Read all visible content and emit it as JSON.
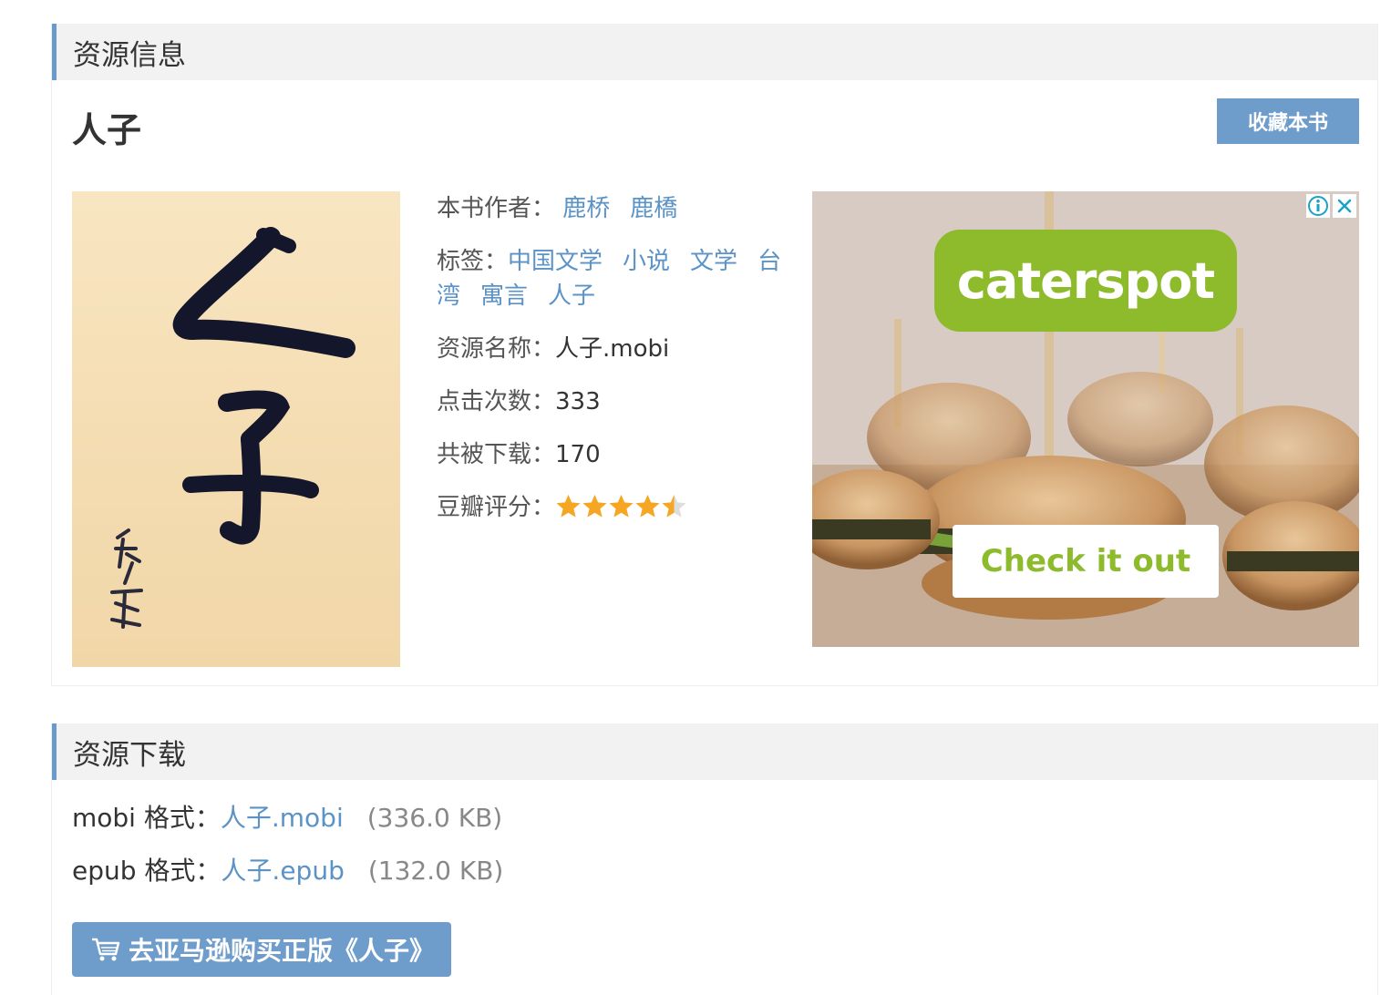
{
  "info_panel": {
    "heading": "资源信息",
    "book_title": "人子",
    "favorite_label": "收藏本书",
    "cover_calligraphy": "人子",
    "cover_signature": "鹿橋",
    "author_label": "本书作者：",
    "authors": [
      "鹿桥",
      "鹿橋"
    ],
    "tags_label": "标签：",
    "tags": [
      "中国文学",
      "小说",
      "文学",
      "台湾",
      "寓言",
      "人子"
    ],
    "resource_name_label": "资源名称：",
    "resource_name": "人子.mobi",
    "clicks_label": "点击次数：",
    "clicks": "333",
    "downloads_label": "共被下载：",
    "downloads": "170",
    "rating_label": "豆瓣评分：",
    "rating_stars": 4.5,
    "rating_max": 5
  },
  "ad": {
    "brand": "caterspot",
    "cta": "Check it out",
    "icons": [
      "info-icon",
      "close-icon"
    ],
    "brand_color": "#8dbb2c"
  },
  "download_panel": {
    "heading": "资源下载",
    "files": [
      {
        "format_label": "mobi 格式：",
        "file_name": "人子.mobi",
        "size": "(336.0 KB)"
      },
      {
        "format_label": "epub 格式：",
        "file_name": "人子.epub",
        "size": "(132.0 KB)"
      }
    ],
    "buy_label": "去亚马逊购买正版《人子》"
  },
  "colors": {
    "accent": "#6e9ccb",
    "link": "#5b93c7",
    "star": "#f5a623"
  }
}
